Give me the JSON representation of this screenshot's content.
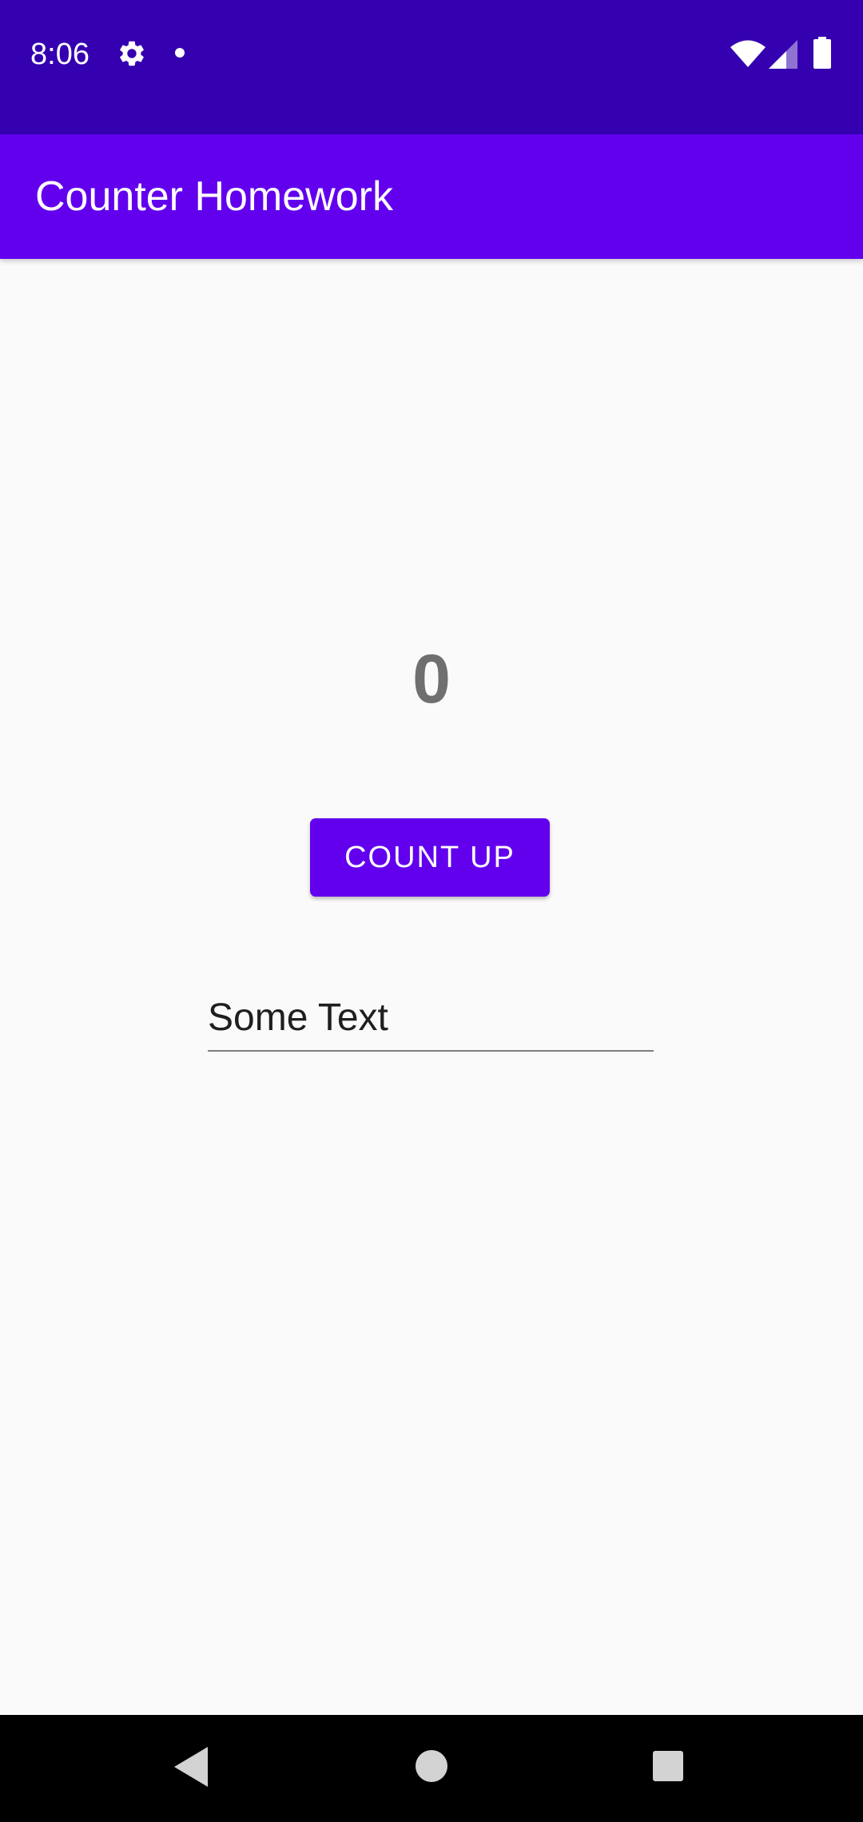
{
  "status_bar": {
    "time": "8:06",
    "icons": [
      "gear-icon",
      "notification-dot-icon",
      "wifi-icon",
      "signal-icon",
      "battery-icon"
    ],
    "color": "#3400b0"
  },
  "app_bar": {
    "title": "Counter Homework",
    "color": "#6200ee"
  },
  "main": {
    "count_value": "0",
    "count_button_label": "COUNT UP",
    "text_field_value": "Some Text"
  },
  "nav_bar": {
    "icons": [
      "back-icon",
      "home-icon",
      "recents-icon"
    ]
  },
  "colors": {
    "primary": "#6200ee",
    "primary_dark": "#3700b3",
    "background": "#fafafa",
    "counter_text": "#6f6f6f"
  }
}
